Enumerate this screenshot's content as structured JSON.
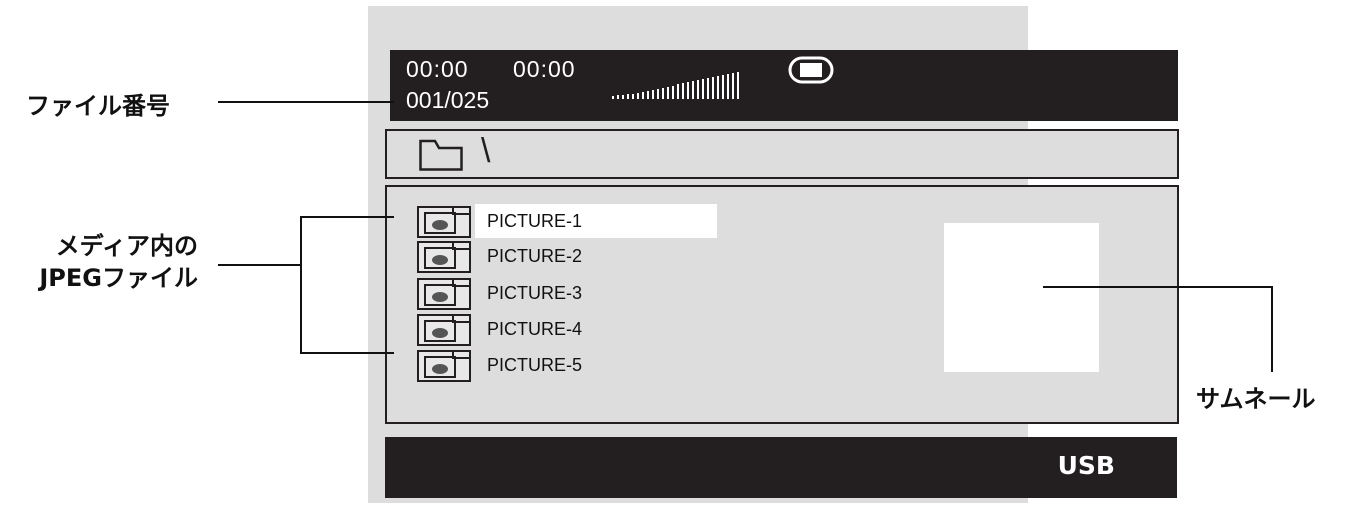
{
  "status": {
    "elapsed_time": "00:00",
    "total_time": "00:00",
    "file_number": "001/025"
  },
  "path": {
    "folder_icon": "folder-icon",
    "current_path": "\\"
  },
  "files": [
    {
      "name": "PICTURE-1",
      "selected": true
    },
    {
      "name": "PICTURE-2",
      "selected": false
    },
    {
      "name": "PICTURE-3",
      "selected": false
    },
    {
      "name": "PICTURE-4",
      "selected": false
    },
    {
      "name": "PICTURE-5",
      "selected": false
    }
  ],
  "source": "USB",
  "callouts": {
    "file_number": "ファイル番号",
    "jpeg_line1": "メディア内の",
    "jpeg_line2": "JPEGファイル",
    "thumbnail": "サムネール"
  },
  "colors": {
    "bar": "#231f20",
    "screen": "#dcdddc",
    "highlight": "#ffffff"
  }
}
